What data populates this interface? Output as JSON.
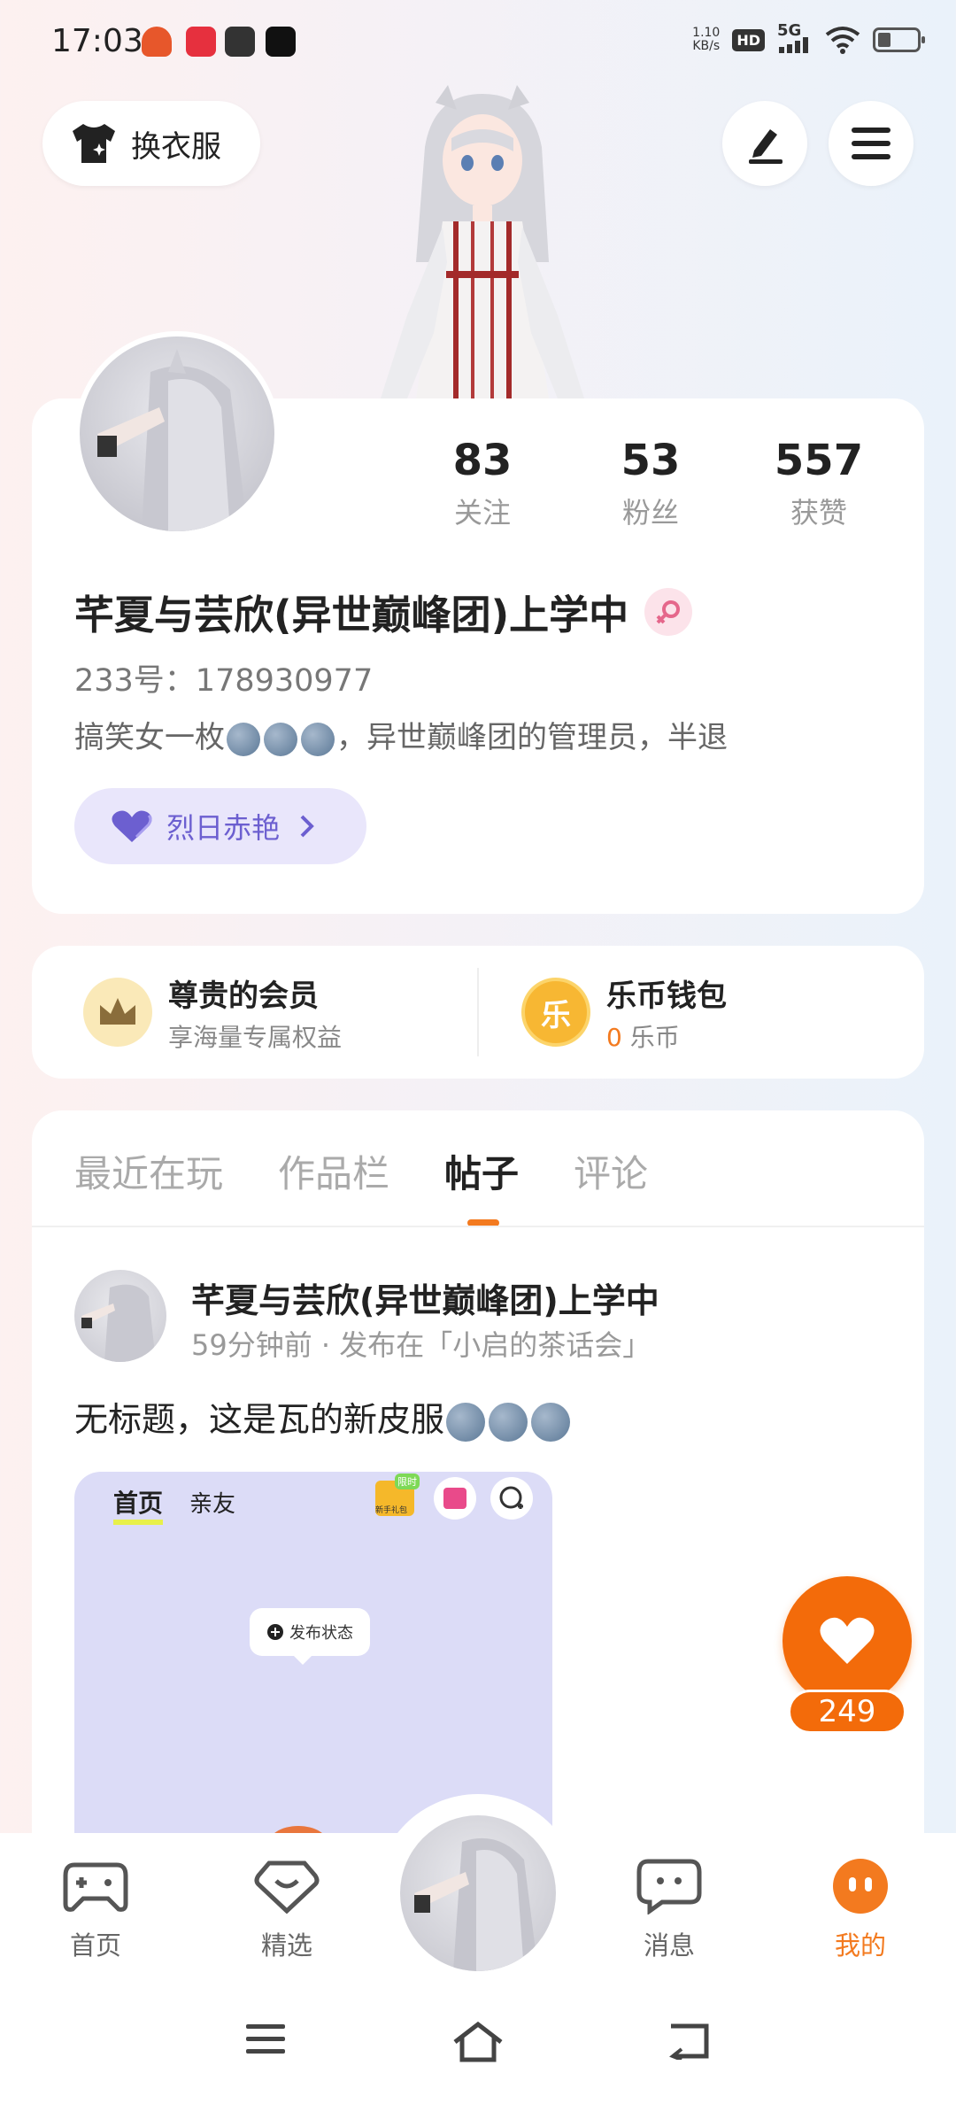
{
  "status_bar": {
    "time": "17:03",
    "net_speed_value": "1.10",
    "net_speed_unit": "KB/s",
    "hd": "HD",
    "signal": "5G"
  },
  "header": {
    "outfit_label": "换衣服",
    "edit_icon": "edit-icon",
    "menu_icon": "menu-icon"
  },
  "profile": {
    "stats": [
      {
        "value": "83",
        "label": "关注"
      },
      {
        "value": "53",
        "label": "粉丝"
      },
      {
        "value": "557",
        "label": "获赞"
      }
    ],
    "username": "芊夏与芸欣(异世巅峰团)上学中",
    "uid": "233号：178930977",
    "bio_prefix": "搞笑女一枚",
    "bio_suffix": "，异世巅峰团的管理员，半退",
    "title_badge": "烈日赤艳"
  },
  "member": {
    "title": "尊贵的会员",
    "subtitle": "享海量专属权益"
  },
  "wallet": {
    "title": "乐币钱包",
    "icon_char": "乐",
    "amount": "0",
    "unit": "乐币"
  },
  "tabs": [
    "最近在玩",
    "作品栏",
    "帖子",
    "评论"
  ],
  "active_tab": "帖子",
  "post": {
    "author": "芊夏与芸欣(异世巅峰团)上学中",
    "meta": "59分钟前 · 发布在「小启的茶话会」",
    "text": "无标题，这是瓦的新皮服",
    "image": {
      "tab_home": "首页",
      "tab_friends": "亲友",
      "badge": "限时",
      "gift_label": "新手礼包",
      "bubble": "发布状态"
    }
  },
  "like": {
    "count": "249"
  },
  "bottom_nav": [
    {
      "label": "首页",
      "icon": "gamepad-icon"
    },
    {
      "label": "精选",
      "icon": "heart-box-icon"
    },
    {
      "label": "消息",
      "icon": "chat-icon"
    },
    {
      "label": "我的",
      "icon": "face-icon"
    }
  ],
  "colors": {
    "accent": "#f37a1f",
    "like": "#f36b0a",
    "title_purple": "#6c5fd0"
  }
}
